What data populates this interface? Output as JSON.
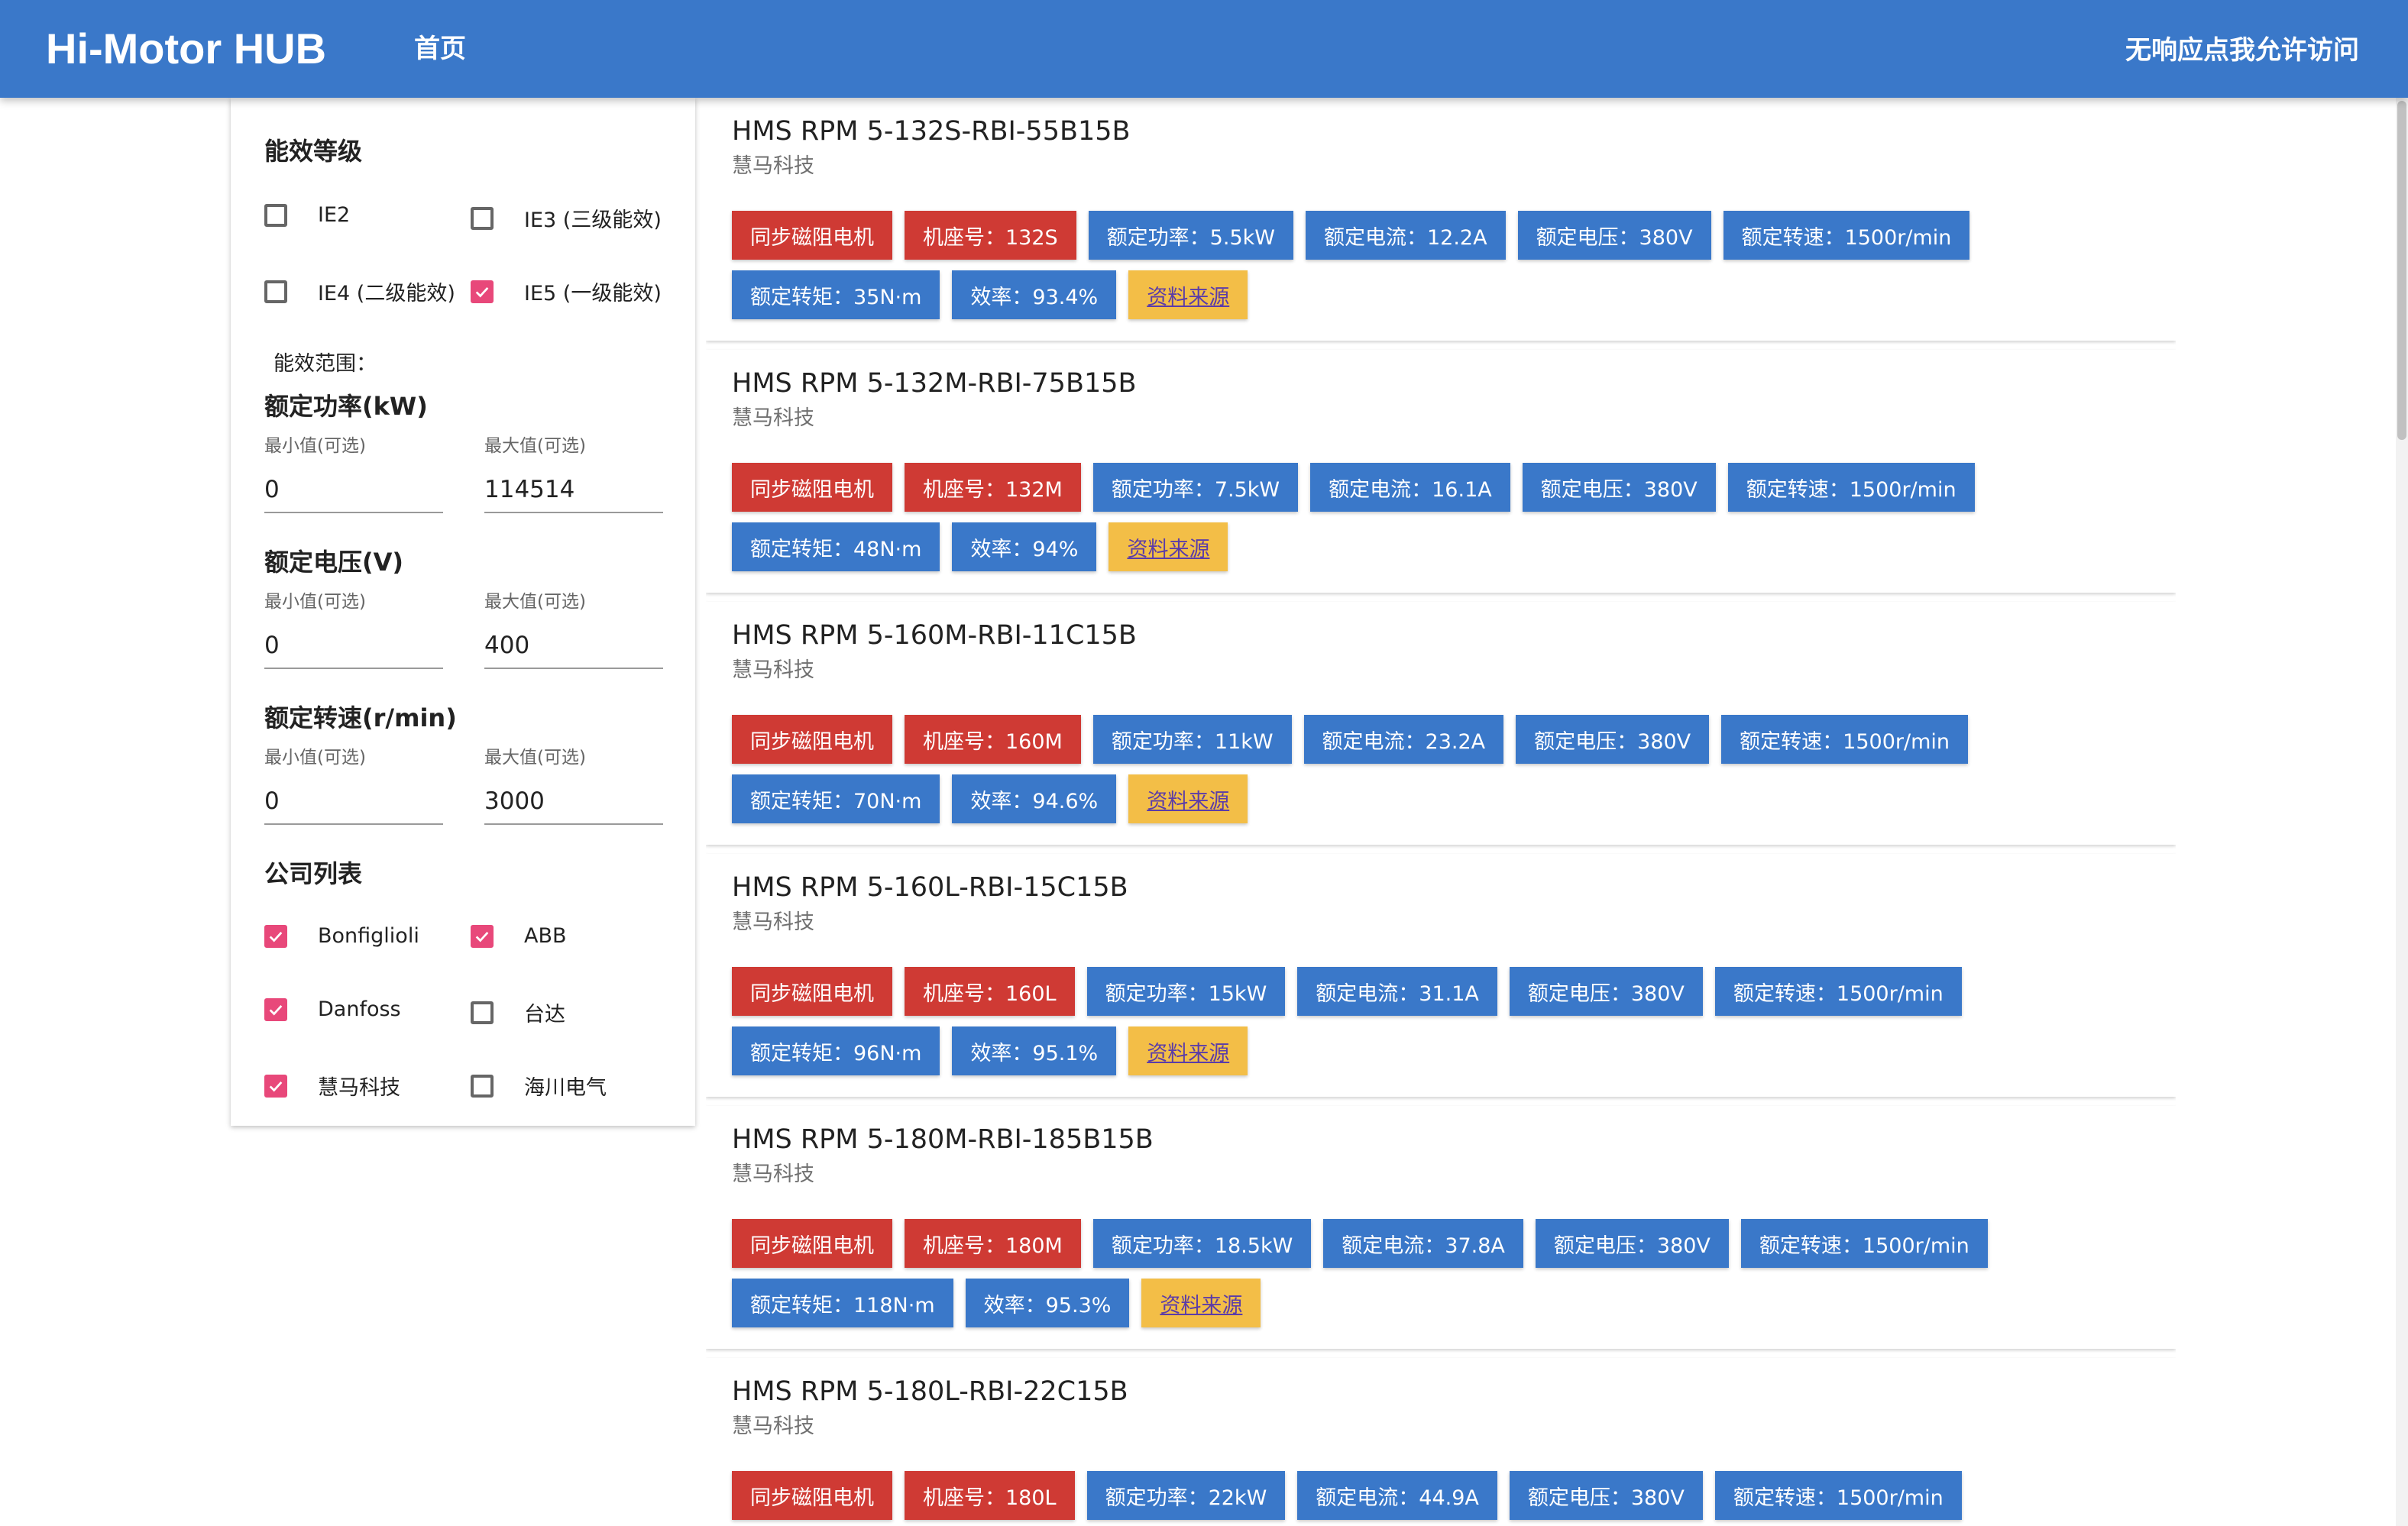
{
  "header": {
    "app_title": "Hi-Motor HUB",
    "nav_home": "首页",
    "nav_right": "无响应点我允许访问"
  },
  "filters": {
    "efficiency_heading": "能效等级",
    "efficiency_options": [
      {
        "label": "IE2",
        "checked": false
      },
      {
        "label": "IE3 (三级能效)",
        "checked": false
      },
      {
        "label": "IE4 (二级能效)",
        "checked": false
      },
      {
        "label": "IE5 (一级能效)",
        "checked": true
      }
    ],
    "range_note": "能效范围：",
    "power": {
      "heading": "额定功率(kW)",
      "min_label": "最小值(可选)",
      "max_label": "最大值(可选)",
      "min_value": "0",
      "max_value": "114514"
    },
    "voltage": {
      "heading": "额定电压(V)",
      "min_label": "最小值(可选)",
      "max_label": "最大值(可选)",
      "min_value": "0",
      "max_value": "400"
    },
    "speed": {
      "heading": "额定转速(r/min)",
      "min_label": "最小值(可选)",
      "max_label": "最大值(可选)",
      "min_value": "0",
      "max_value": "3000"
    },
    "company_heading": "公司列表",
    "companies": [
      {
        "label": "Bonfiglioli",
        "checked": true
      },
      {
        "label": "ABB",
        "checked": true
      },
      {
        "label": "Danfoss",
        "checked": true
      },
      {
        "label": "台达",
        "checked": false
      },
      {
        "label": "慧马科技",
        "checked": true
      },
      {
        "label": "海川电气",
        "checked": false
      }
    ]
  },
  "results": [
    {
      "title": "HMS RPM 5-132S-RBI-55B15B",
      "company": "慧马科技",
      "type": "同步磁阻电机",
      "frame": "机座号：132S",
      "power": "额定功率：5.5kW",
      "current": "额定电流：12.2A",
      "voltage": "额定电压：380V",
      "speed": "额定转速：1500r/min",
      "torque": "额定转矩：35N·m",
      "efficiency": "效率：93.4%",
      "source": "资料来源"
    },
    {
      "title": "HMS RPM 5-132M-RBI-75B15B",
      "company": "慧马科技",
      "type": "同步磁阻电机",
      "frame": "机座号：132M",
      "power": "额定功率：7.5kW",
      "current": "额定电流：16.1A",
      "voltage": "额定电压：380V",
      "speed": "额定转速：1500r/min",
      "torque": "额定转矩：48N·m",
      "efficiency": "效率：94%",
      "source": "资料来源"
    },
    {
      "title": "HMS RPM 5-160M-RBI-11C15B",
      "company": "慧马科技",
      "type": "同步磁阻电机",
      "frame": "机座号：160M",
      "power": "额定功率：11kW",
      "current": "额定电流：23.2A",
      "voltage": "额定电压：380V",
      "speed": "额定转速：1500r/min",
      "torque": "额定转矩：70N·m",
      "efficiency": "效率：94.6%",
      "source": "资料来源"
    },
    {
      "title": "HMS RPM 5-160L-RBI-15C15B",
      "company": "慧马科技",
      "type": "同步磁阻电机",
      "frame": "机座号：160L",
      "power": "额定功率：15kW",
      "current": "额定电流：31.1A",
      "voltage": "额定电压：380V",
      "speed": "额定转速：1500r/min",
      "torque": "额定转矩：96N·m",
      "efficiency": "效率：95.1%",
      "source": "资料来源"
    },
    {
      "title": "HMS RPM 5-180M-RBI-185B15B",
      "company": "慧马科技",
      "type": "同步磁阻电机",
      "frame": "机座号：180M",
      "power": "额定功率：18.5kW",
      "current": "额定电流：37.8A",
      "voltage": "额定电压：380V",
      "speed": "额定转速：1500r/min",
      "torque": "额定转矩：118N·m",
      "efficiency": "效率：95.3%",
      "source": "资料来源"
    },
    {
      "title": "HMS RPM 5-180L-RBI-22C15B",
      "company": "慧马科技",
      "type": "同步磁阻电机",
      "frame": "机座号：180L",
      "power": "额定功率：22kW",
      "current": "额定电流：44.9A",
      "voltage": "额定电压：380V",
      "speed": "额定转速：1500r/min",
      "torque": "",
      "efficiency": "",
      "source": ""
    }
  ],
  "colors": {
    "primary": "#3a78c9",
    "chip_red": "#cf3a34",
    "chip_yellow": "#f3be47",
    "checkbox_checked": "#e8487a"
  }
}
